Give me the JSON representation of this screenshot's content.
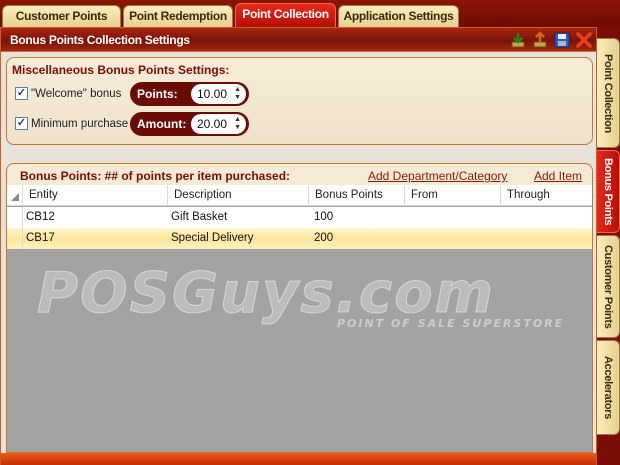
{
  "top_tabs": [
    {
      "label": "Customer Points",
      "active": false
    },
    {
      "label": "Point Redemption",
      "active": false
    },
    {
      "label": "Point Collection",
      "active": true
    },
    {
      "label": "Application Settings",
      "active": false
    }
  ],
  "panel": {
    "title": "Bonus Points Collection Settings",
    "icons": [
      "import-icon",
      "export-icon",
      "save-icon",
      "close-icon"
    ]
  },
  "misc": {
    "title": "Miscellaneous Bonus Points Settings:",
    "welcome_bonus": {
      "label": "\"Welcome\" bonus",
      "checked": true,
      "field_label": "Points:",
      "value": "10.00"
    },
    "minimum_purchase": {
      "label": "Minimum purchase",
      "checked": true,
      "field_label": "Amount:",
      "value": "20.00"
    }
  },
  "grid": {
    "title": "Bonus Points: ## of points per item purchased:",
    "add_department_link": "Add Department/Category",
    "add_item_link": "Add Item",
    "columns": [
      "Entity",
      "Description",
      "Bonus Points",
      "From",
      "Through"
    ],
    "rows": [
      {
        "entity": "CB12",
        "description": "Gift Basket",
        "bonus_points": "100",
        "from": "",
        "through": ""
      },
      {
        "entity": "CB17",
        "description": "Special Delivery",
        "bonus_points": "200",
        "from": "",
        "through": ""
      }
    ],
    "watermark": "POSGuys.com",
    "watermark_sub": "POINT OF SALE SUPERSTORE"
  },
  "side_tabs": [
    {
      "label": "Point Collection",
      "active": false
    },
    {
      "label": "Bonus Points",
      "active": true
    },
    {
      "label": "Customer Points",
      "active": false
    },
    {
      "label": "Accelerators",
      "active": false
    }
  ],
  "colors": {
    "accent": "#b50f05",
    "frame": "#7a0d05",
    "tab_inactive": "#f3e0a6"
  }
}
